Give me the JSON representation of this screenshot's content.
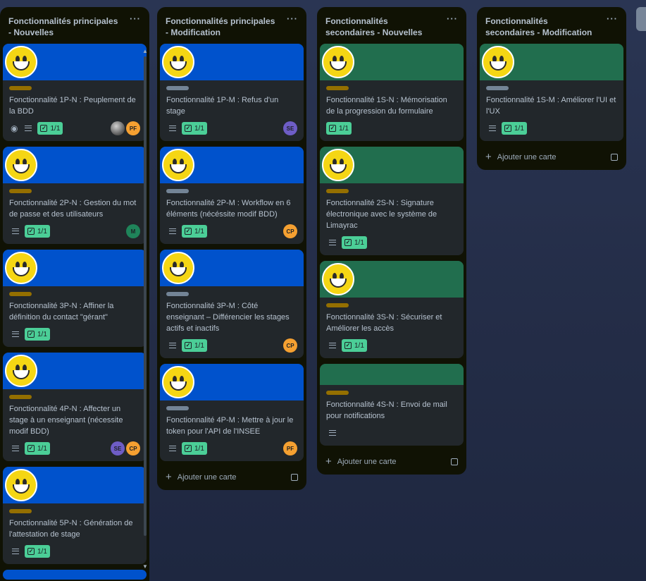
{
  "lists": [
    {
      "title": "Fonctionnalités principales - Nouvelles",
      "menu": "···",
      "add_card": "Ajouter une carte",
      "cards": [
        {
          "cover": "blue",
          "smiley": true,
          "label": "gold",
          "title": "Fonctionnalité 1P-N : Peuplement de la BDD",
          "watch": true,
          "desc": true,
          "check": "1/1",
          "members": [
            {
              "initials": "",
              "color": "#8a8f96",
              "photo": true
            },
            {
              "initials": "PF",
              "color": "#f5a031"
            }
          ]
        },
        {
          "cover": "blue",
          "smiley": true,
          "label": "gold",
          "title": "Fonctionnalité 2P-N : Gestion du mot de passe et des utilisateurs",
          "desc": true,
          "check": "1/1",
          "members": [
            {
              "initials": "M",
              "color": "#1f845a"
            }
          ]
        },
        {
          "cover": "blue",
          "smiley": true,
          "label": "gold",
          "title": "Fonctionnalité 3P-N : Affiner la définition du contact \"gérant\"",
          "desc": true,
          "check": "1/1",
          "members": []
        },
        {
          "cover": "blue",
          "smiley": true,
          "label": "gold",
          "title": "Fonctionnalité 4P-N : Affecter un stage à un enseignant (nécessite modif BDD)",
          "desc": true,
          "check": "1/1",
          "members": [
            {
              "initials": "SE",
              "color": "#6e5dc6"
            },
            {
              "initials": "CP",
              "color": "#f5a031"
            }
          ]
        },
        {
          "cover": "blue",
          "smiley": true,
          "label": "gold",
          "title": "Fonctionnalité 5P-N : Génération de l'attestation de stage",
          "desc": true,
          "check": "1/1",
          "members": []
        }
      ]
    },
    {
      "title": "Fonctionnalités principales - Modification",
      "menu": "···",
      "add_card": "Ajouter une carte",
      "cards": [
        {
          "cover": "blue",
          "smiley": true,
          "label": "gray",
          "title": "Fonctionnalité 1P-M : Refus d'un stage",
          "desc": true,
          "check": "1/1",
          "members": [
            {
              "initials": "SE",
              "color": "#6e5dc6"
            }
          ]
        },
        {
          "cover": "blue",
          "smiley": true,
          "label": "gray",
          "title": "Fonctionnalité 2P-M : Workflow en 6 éléments (nécéssite modif BDD)",
          "desc": true,
          "check": "1/1",
          "members": [
            {
              "initials": "CP",
              "color": "#f5a031"
            }
          ]
        },
        {
          "cover": "blue",
          "smiley": true,
          "label": "gray",
          "title": "Fonctionnalité 3P-M : Côté enseignant – Différencier les stages actifs et inactifs",
          "desc": true,
          "check": "1/1",
          "members": [
            {
              "initials": "CP",
              "color": "#f5a031"
            }
          ]
        },
        {
          "cover": "blue",
          "smiley": true,
          "label": "gray",
          "title": "Fonctionnalité 4P-M : Mettre à jour le token pour l'API de l'INSEE",
          "desc": true,
          "check": "1/1",
          "members": [
            {
              "initials": "PF",
              "color": "#f5a031"
            }
          ]
        }
      ]
    },
    {
      "title": "Fonctionnalités secondaires - Nouvelles",
      "menu": "···",
      "add_card": "Ajouter une carte",
      "cards": [
        {
          "cover": "green",
          "smiley": true,
          "label": "gold",
          "title": "Fonctionnalité 1S-N : Mémorisation de la progression du formulaire",
          "desc": false,
          "check": "1/1",
          "members": []
        },
        {
          "cover": "green",
          "smiley": true,
          "label": "gold",
          "title": "Fonctionnalité 2S-N : Signature électronique avec le système de Limayrac",
          "desc": true,
          "check": "1/1",
          "members": []
        },
        {
          "cover": "green",
          "smiley": true,
          "label": "gold",
          "title": "Fonctionnalité 3S-N : Sécuriser et Améliorer les accès",
          "desc": true,
          "check": "1/1",
          "members": []
        },
        {
          "cover": "green",
          "smiley": false,
          "cover_small": true,
          "label": "gold",
          "title": "Fonctionnalité 4S-N : Envoi de mail pour notifications",
          "desc": true,
          "check": "",
          "members": []
        }
      ]
    },
    {
      "title": "Fonctionnalités secondaires - Modification",
      "menu": "···",
      "add_card": "Ajouter une carte",
      "cards": [
        {
          "cover": "green",
          "smiley": true,
          "label": "gray",
          "title": "Fonctionnalité 1S-M : Améliorer l'UI et l'UX",
          "desc": true,
          "check": "1/1",
          "members": []
        }
      ]
    }
  ]
}
